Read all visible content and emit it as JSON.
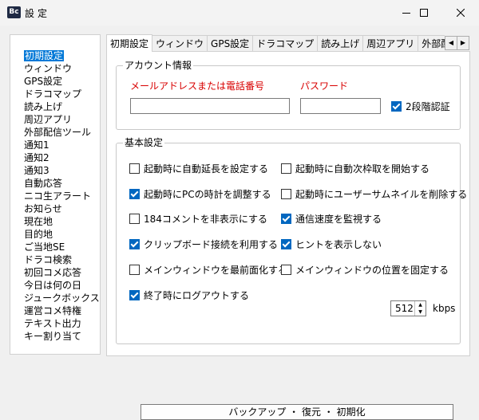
{
  "window": {
    "icon_text": "Bc",
    "title": "設定",
    "minimize_icon": "minimize-icon",
    "maximize_icon": "maximize-icon",
    "close_icon": "close-icon"
  },
  "sidebar": {
    "items": [
      "初期設定",
      "ウィンドウ",
      "GPS設定",
      "ドラコマップ",
      "読み上げ",
      "周辺アプリ",
      "外部配信ツール",
      "通知1",
      "通知2",
      "通知3",
      "自動応答",
      "ニコ生アラート",
      "お知らせ",
      "現在地",
      "目的地",
      "ご当地SE",
      "ドラコ検索",
      "初回コメ応答",
      "今日は何の日",
      "ジュークボックス",
      "運営コメ特権",
      "テキスト出力",
      "キー割り当て"
    ],
    "selected_index": 0
  },
  "tabs": {
    "items": [
      "初期設定",
      "ウィンドウ",
      "GPS設定",
      "ドラコマップ",
      "読み上げ",
      "周辺アプリ",
      "外部配信ツ"
    ],
    "active_index": 0,
    "left_arrow": "◀",
    "right_arrow": "▶"
  },
  "account": {
    "group_title": "アカウント情報",
    "email_label": "メールアドレスまたは電話番号",
    "email_value": "",
    "password_label": "パスワード",
    "password_value": "",
    "two_factor_label": "2段階認証",
    "two_factor_checked": true
  },
  "basic": {
    "group_title": "基本設定",
    "options": [
      {
        "label": "起動時に自動延長を設定する",
        "checked": false
      },
      {
        "label": "起動時に自動次枠取を開始する",
        "checked": false
      },
      {
        "label": "起動時にPCの時計を調整する",
        "checked": true
      },
      {
        "label": "起動時にユーザーサムネイルを削除する",
        "checked": false
      },
      {
        "label": "184コメントを非表示にする",
        "checked": false
      },
      {
        "label": "通信速度を監視する",
        "checked": true
      },
      {
        "label": "クリップボード接続を利用する",
        "checked": true
      },
      {
        "label": "ヒントを表示しない",
        "checked": true
      },
      {
        "label": "メインウィンドウを最前面化する",
        "checked": false
      },
      {
        "label": "メインウィンドウの位置を固定する",
        "checked": false
      },
      {
        "label": "終了時にログアウトする",
        "checked": true
      }
    ],
    "speed_value": "512",
    "speed_unit": "kbps",
    "backup_button": "バックアップ ・ 復元 ・ 初期化"
  },
  "colors": {
    "accent": "#0067c0",
    "selection": "#0078d7",
    "required_label": "#d80000"
  }
}
